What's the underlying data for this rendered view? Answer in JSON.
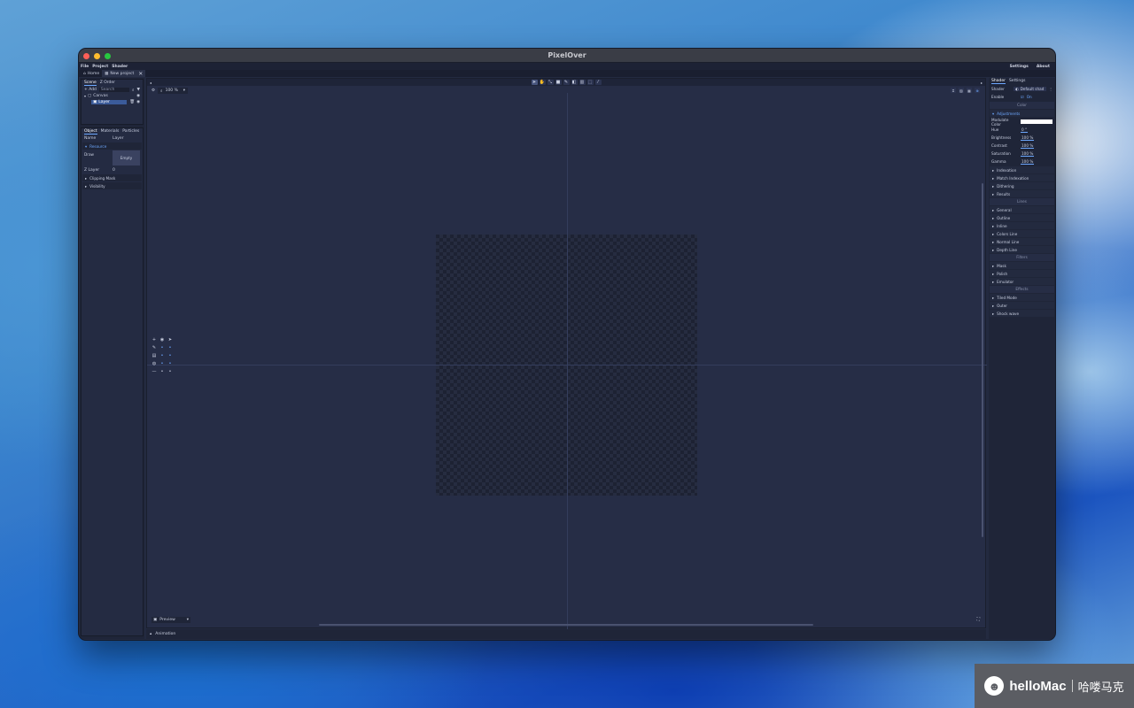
{
  "app": {
    "title": "PixelOver"
  },
  "menubar": {
    "items": [
      "File",
      "Project",
      "Shader"
    ],
    "right": [
      "Settings",
      "About"
    ]
  },
  "tabs": [
    {
      "label": "Home"
    },
    {
      "label": "New project"
    }
  ],
  "scene": {
    "tabs": [
      "Scene",
      "Z Order"
    ],
    "add_label": "+ Add",
    "search_placeholder": "Search",
    "tree": [
      {
        "label": "Canvas"
      },
      {
        "label": "Layer"
      }
    ]
  },
  "object_panel": {
    "tabs": [
      "Object",
      "Materials",
      "Particles"
    ],
    "name_label": "Name",
    "name_value": "Layer",
    "resource_section": "Resource",
    "draw_label": "Draw",
    "draw_value": "Empty",
    "zlayer_label": "Z Layer",
    "zlayer_value": "0",
    "sections": [
      "Clipping Mask",
      "Visibility"
    ]
  },
  "canvas": {
    "zoom_value": "100 %",
    "preview_label": "Preview",
    "animation_label": "Animation"
  },
  "shader_panel": {
    "tabs": [
      "Shader",
      "Settings"
    ],
    "shader_label": "Shader",
    "shader_value": "Default shad",
    "enable_label": "Enable",
    "enable_value": "On",
    "color_group": "Color",
    "adjustments": "Adjustments",
    "rows": [
      {
        "label": "Modulate Color",
        "value": ""
      },
      {
        "label": "Hue",
        "value": "0 °"
      },
      {
        "label": "Brightness",
        "value": "100 %"
      },
      {
        "label": "Contrast",
        "value": "100 %"
      },
      {
        "label": "Saturation",
        "value": "100 %"
      },
      {
        "label": "Gamma",
        "value": "100 %"
      }
    ],
    "color_items": [
      "Indexation",
      "Match Indexation",
      "Dithering",
      "Results"
    ],
    "lines_group": "Lines",
    "lines_items": [
      "General",
      "Outline",
      "Inline",
      "Colors Line",
      "Normal Line",
      "Depth Line"
    ],
    "filters_group": "Filters",
    "filters_items": [
      "Mask",
      "Polish",
      "Emulator"
    ],
    "effects_group": "Effects",
    "effects_items": [
      "Tiled Mode",
      "Outer",
      "Shock wave"
    ]
  },
  "watermark": {
    "brand": "helloMac",
    "cn": "哈喽马克"
  },
  "colors": {
    "accent": "#6da8ff",
    "bg": "#232a40"
  }
}
